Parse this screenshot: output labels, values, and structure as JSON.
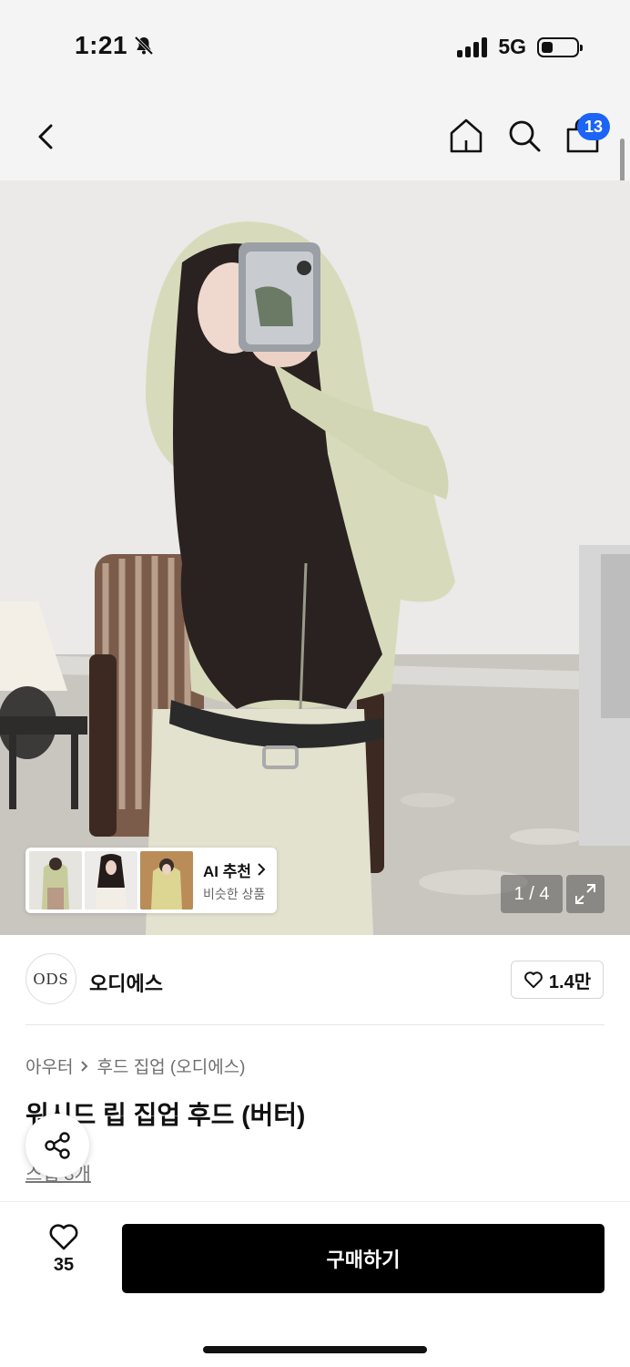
{
  "status_bar": {
    "time": "1:21",
    "network": "5G",
    "icons": [
      "bell-muted-icon",
      "signal-icon",
      "battery-icon"
    ]
  },
  "nav": {
    "cart_count": "13",
    "icons": [
      "chevron-left-icon",
      "home-icon",
      "search-icon",
      "shopping-bag-icon"
    ]
  },
  "hero": {
    "page_indicator": "1 / 4",
    "ai_card": {
      "title": "AI 추천",
      "subtitle": "비슷한 상품"
    }
  },
  "brand": {
    "logo_text": "ODS",
    "name": "오디에스",
    "likes": "1.4만"
  },
  "product": {
    "breadcrumb": [
      "아우터",
      "후드 집업 (오디에스)"
    ],
    "title": "워시드 립 집업 후드 (버터)",
    "review_text": "스냅 3개"
  },
  "bottom_bar": {
    "wish_count": "35",
    "buy_label": "구매하기"
  },
  "colors": {
    "accent_badge": "#1b64f5",
    "buy_button": "#000000"
  }
}
